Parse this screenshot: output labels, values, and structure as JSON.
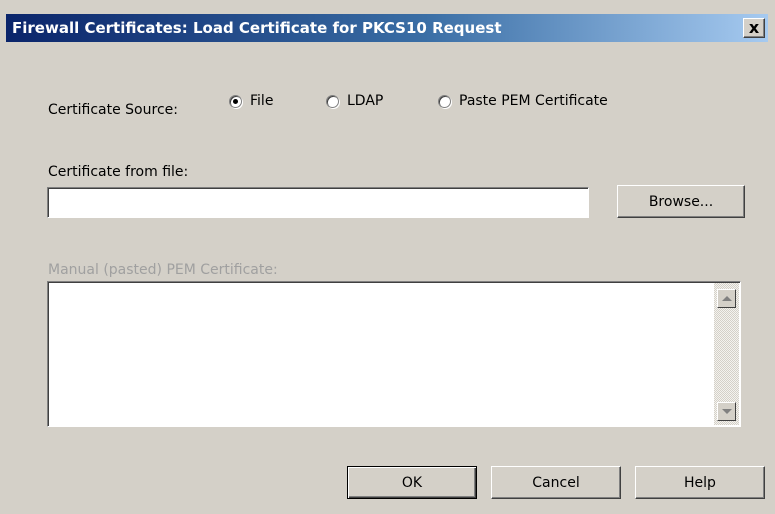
{
  "window": {
    "title": "Firewall Certificates: Load Certificate for PKCS10 Request",
    "close_label": "x"
  },
  "source": {
    "label": "Certificate Source:",
    "options": [
      {
        "label": "File",
        "checked": true
      },
      {
        "label": "LDAP",
        "checked": false
      },
      {
        "label": "Paste PEM Certificate",
        "checked": false
      }
    ]
  },
  "file": {
    "label": "Certificate from file:",
    "value": "",
    "browse_label": "Browse..."
  },
  "pem": {
    "label": "Manual (pasted) PEM Certificate:",
    "value": "",
    "disabled": true
  },
  "buttons": {
    "ok": "OK",
    "cancel": "Cancel",
    "help": "Help"
  },
  "colors": {
    "dialog_bg": "#d4d0c8",
    "title_start": "#0a246a",
    "title_end": "#a6caf0",
    "disabled_text": "#a0a0a0"
  }
}
